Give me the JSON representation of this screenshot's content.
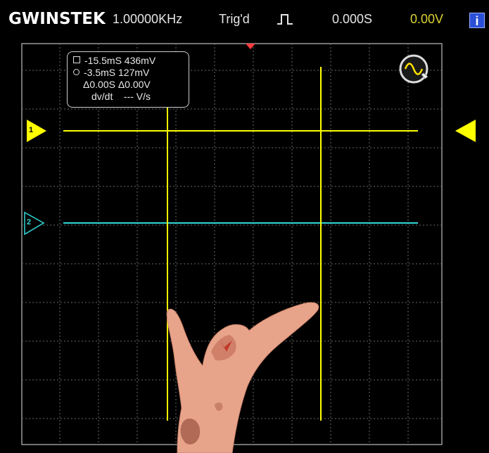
{
  "header": {
    "brand": "GWINSTEK",
    "frequency": "1.00000KHz",
    "trigger_status": "Trig'd",
    "time_offset": "0.000S",
    "voltage": "0.00V",
    "info_label": "i"
  },
  "cursor_readout": {
    "cursor1": "-15.5mS 436mV",
    "cursor2": "-3.5mS  127mV",
    "delta": "Δ0.00S  Δ0.00V",
    "slope_label": "dv/dt",
    "slope_value": "--- V/s"
  },
  "channels": [
    {
      "label": "1",
      "color": "#ffff00"
    },
    {
      "label": "2",
      "color": "#33d6d6"
    }
  ],
  "colors": {
    "ch1": "#ffff00",
    "ch2": "#33d6d6",
    "grid": "#5a5a5a",
    "trigger_marker": "#ff3b3b"
  },
  "icons": {
    "trigger_edge": "rising-pulse-icon",
    "waveform_button": "sine-wave-icon",
    "hand": "pointing-hand-illustration"
  }
}
